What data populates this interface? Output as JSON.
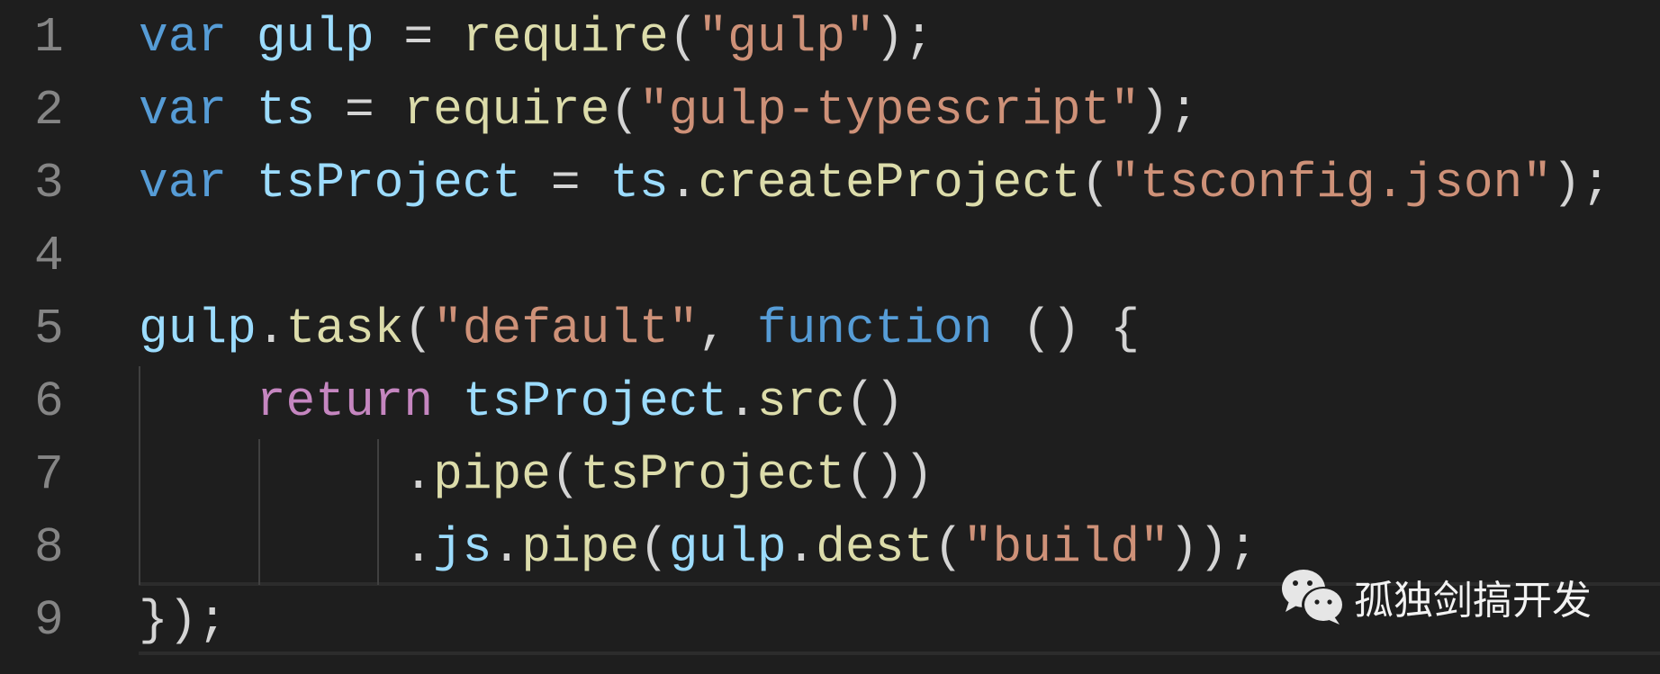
{
  "editor": {
    "lines": [
      {
        "number": "1",
        "tokens": [
          [
            "kw",
            "var"
          ],
          [
            "pn",
            " "
          ],
          [
            "id",
            "gulp"
          ],
          [
            "pn",
            " = "
          ],
          [
            "fn",
            "require"
          ],
          [
            "pn",
            "("
          ],
          [
            "str",
            "\"gulp\""
          ],
          [
            "pn",
            ");"
          ]
        ]
      },
      {
        "number": "2",
        "tokens": [
          [
            "kw",
            "var"
          ],
          [
            "pn",
            " "
          ],
          [
            "id",
            "ts"
          ],
          [
            "pn",
            " = "
          ],
          [
            "fn",
            "require"
          ],
          [
            "pn",
            "("
          ],
          [
            "str",
            "\"gulp-typescript\""
          ],
          [
            "pn",
            ");"
          ]
        ]
      },
      {
        "number": "3",
        "tokens": [
          [
            "kw",
            "var"
          ],
          [
            "pn",
            " "
          ],
          [
            "id",
            "tsProject"
          ],
          [
            "pn",
            " = "
          ],
          [
            "id",
            "ts"
          ],
          [
            "pn",
            "."
          ],
          [
            "fn",
            "createProject"
          ],
          [
            "pn",
            "("
          ],
          [
            "str",
            "\"tsconfig.json\""
          ],
          [
            "pn",
            ");"
          ]
        ]
      },
      {
        "number": "4",
        "tokens": []
      },
      {
        "number": "5",
        "tokens": [
          [
            "id",
            "gulp"
          ],
          [
            "pn",
            "."
          ],
          [
            "fn",
            "task"
          ],
          [
            "pn",
            "("
          ],
          [
            "str",
            "\"default\""
          ],
          [
            "pn",
            ", "
          ],
          [
            "kw",
            "function"
          ],
          [
            "pn",
            " () {"
          ]
        ]
      },
      {
        "number": "6",
        "tokens": [
          [
            "pn",
            "    "
          ],
          [
            "ctl",
            "return"
          ],
          [
            "pn",
            " "
          ],
          [
            "id",
            "tsProject"
          ],
          [
            "pn",
            "."
          ],
          [
            "fn",
            "src"
          ],
          [
            "pn",
            "()"
          ]
        ]
      },
      {
        "number": "7",
        "tokens": [
          [
            "pn",
            "         ."
          ],
          [
            "fn",
            "pipe"
          ],
          [
            "pn",
            "("
          ],
          [
            "fn",
            "tsProject"
          ],
          [
            "pn",
            "())"
          ]
        ]
      },
      {
        "number": "8",
        "tokens": [
          [
            "pn",
            "         ."
          ],
          [
            "id",
            "js"
          ],
          [
            "pn",
            "."
          ],
          [
            "fn",
            "pipe"
          ],
          [
            "pn",
            "("
          ],
          [
            "id",
            "gulp"
          ],
          [
            "pn",
            "."
          ],
          [
            "fn",
            "dest"
          ],
          [
            "pn",
            "("
          ],
          [
            "str",
            "\"build\""
          ],
          [
            "pn",
            "));"
          ]
        ]
      },
      {
        "number": "9",
        "tokens": [
          [
            "pn",
            "});"
          ]
        ]
      }
    ],
    "current_line": "9"
  },
  "watermark": {
    "icon": "wechat-icon",
    "text": "孤独剑搞开发"
  },
  "colors": {
    "background": "#1e1e1e",
    "keyword": "#569cd6",
    "identifier": "#9cdcfe",
    "function": "#dcdcaa",
    "string": "#ce9178",
    "control": "#c586c0",
    "punctuation": "#d4d4d4",
    "line_number": "#858585"
  }
}
